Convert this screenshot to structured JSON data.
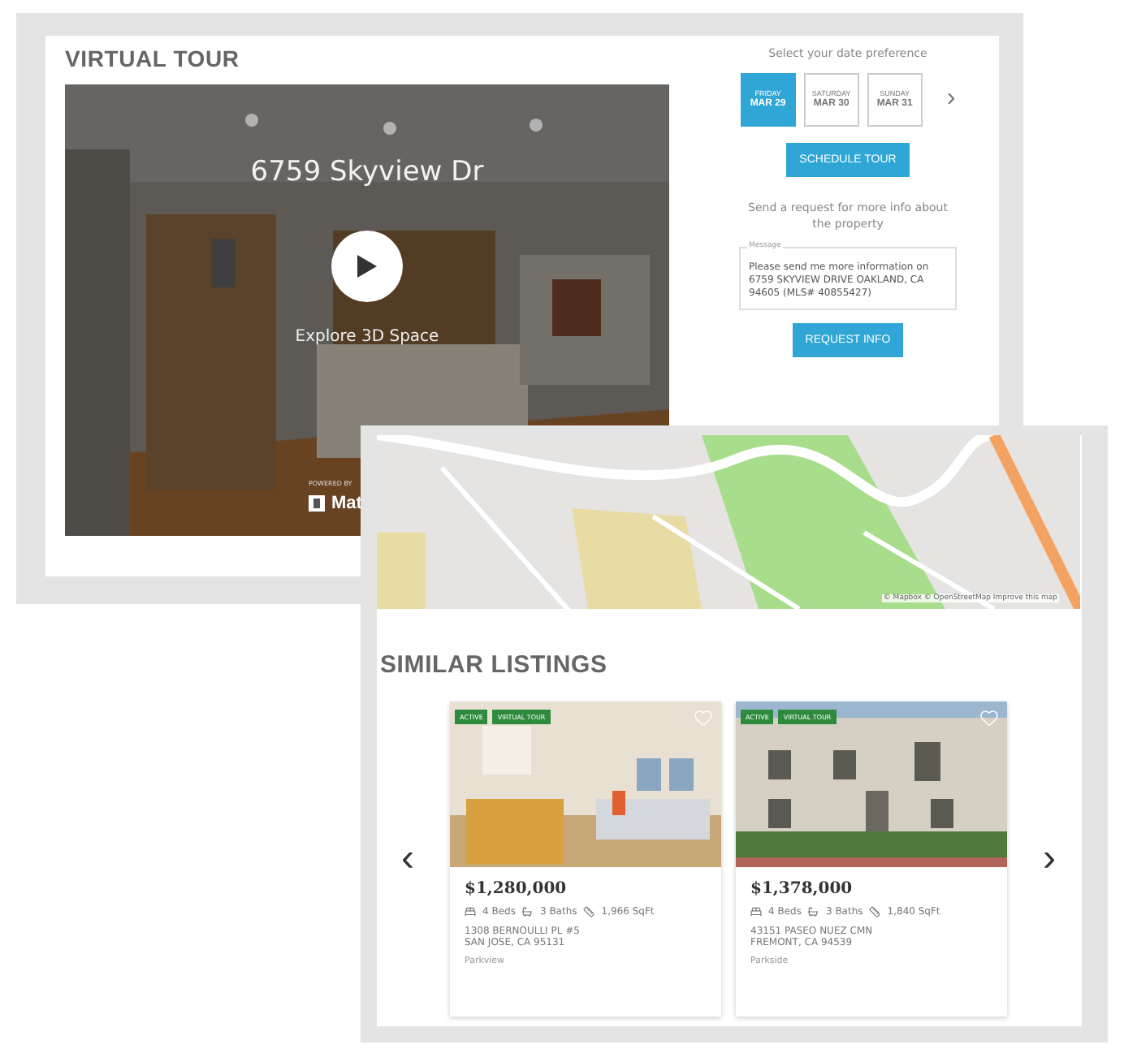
{
  "tour_panel": {
    "title": "VIRTUAL TOUR",
    "video": {
      "address": "6759 Skyview Dr",
      "action": "Explore 3D Space",
      "powered_by": "POWERED BY",
      "brand": "Mat"
    },
    "schedule": {
      "prompt": "Select your date preference",
      "dates": [
        {
          "day": "FRIDAY",
          "date": "MAR 29",
          "selected": true
        },
        {
          "day": "SATURDAY",
          "date": "MAR 30",
          "selected": false
        },
        {
          "day": "SUNDAY",
          "date": "MAR 31",
          "selected": false
        }
      ],
      "next": "›",
      "button": "SCHEDULE TOUR",
      "info_prompt": "Send a request for more info about the property",
      "message": {
        "label": "Message",
        "value": "Please send me more information on 6759 SKYVIEW DRIVE OAKLAND, CA 94605 (MLS# 40855427)"
      },
      "request_button": "REQUEST INFO"
    }
  },
  "listings_panel": {
    "map": {
      "attribution": "© Mapbox © OpenStreetMap Improve this map"
    },
    "title": "SIMILAR LISTINGS",
    "prev": "‹",
    "next": "›",
    "listings": [
      {
        "badges": [
          "ACTIVE",
          "VIRTUAL TOUR"
        ],
        "price": "$1,280,000",
        "beds": "4 Beds",
        "baths": "3 Baths",
        "area": "1,966 SqFt",
        "address": [
          "1308 BERNOULLI PL #5",
          "SAN JOSE, CA 95131"
        ],
        "neighborhood": "Parkview"
      },
      {
        "badges": [
          "ACTIVE",
          "VIRTUAL TOUR"
        ],
        "price": "$1,378,000",
        "beds": "4 Beds",
        "baths": "3 Baths",
        "area": "1,840 SqFt",
        "address": [
          "43151 PASEO NUEZ CMN",
          "FREMONT, CA 94539"
        ],
        "neighborhood": "Parkside"
      }
    ]
  }
}
